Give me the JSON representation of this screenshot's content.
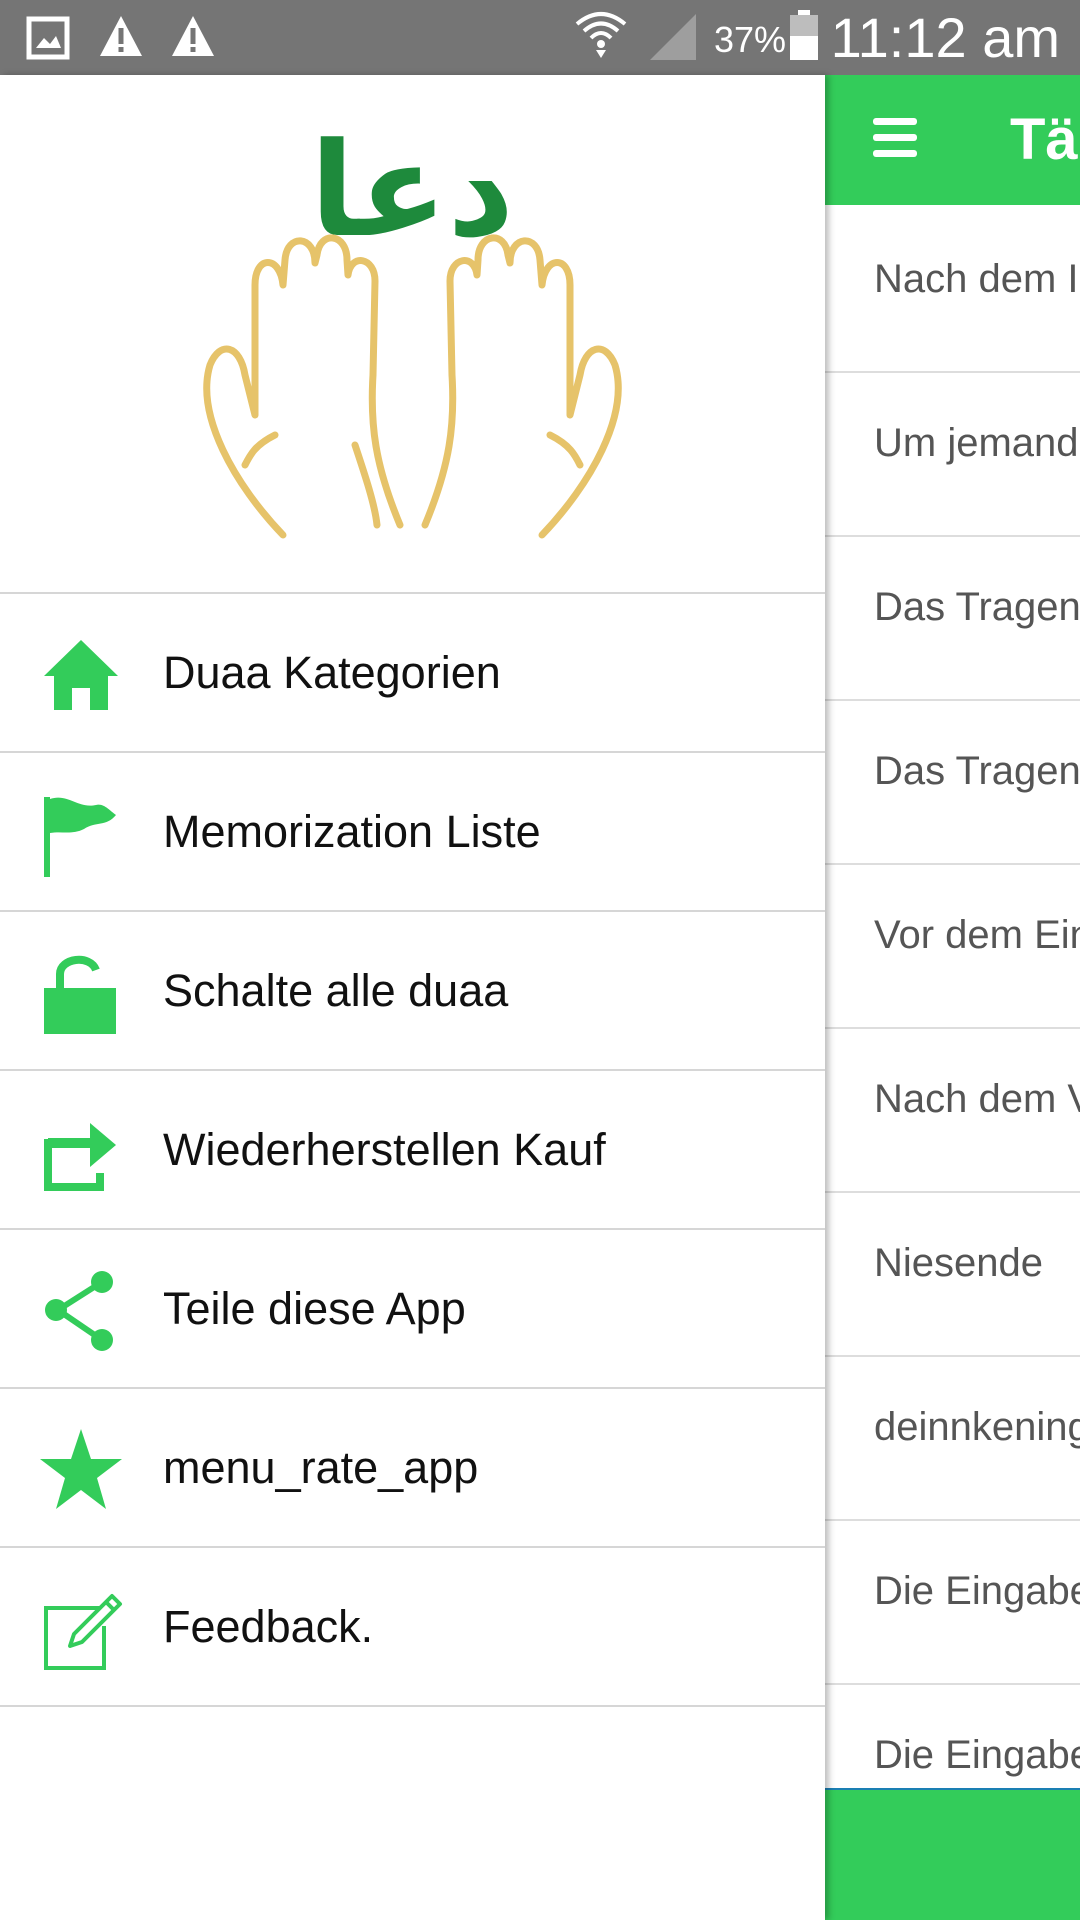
{
  "status_bar": {
    "battery": "37%",
    "time": "11:12 am",
    "icons": [
      "gallery-icon",
      "warning-icon",
      "warning-icon",
      "wifi-icon",
      "signal-icon",
      "battery-icon"
    ]
  },
  "app_bar": {
    "title": "Täg",
    "menu_icon": "hamburger-icon"
  },
  "background_list": {
    "items": [
      "Nach dem I",
      "Um jemand",
      "Das Tragen",
      "Das Tragen",
      "Vor dem Ein",
      "Nach dem V",
      "Niesende",
      "deinnkening",
      "Die Eingabe",
      "Die Eingabe"
    ]
  },
  "drawer": {
    "logo_text": "دعا",
    "menu": [
      {
        "label": "Duaa Kategorien",
        "icon": "home-icon"
      },
      {
        "label": "Memorization Liste",
        "icon": "flag-icon"
      },
      {
        "label": "Schalte alle duaa",
        "icon": "unlock-icon"
      },
      {
        "label": "Wiederherstellen Kauf",
        "icon": "restore-icon"
      },
      {
        "label": "Teile diese App",
        "icon": "share-icon"
      },
      {
        "label": "menu_rate_app",
        "icon": "star-icon"
      },
      {
        "label": "Feedback.",
        "icon": "edit-icon"
      }
    ]
  },
  "colors": {
    "accent": "#33cc5a",
    "status_bar": "#757575",
    "logo_green": "#1e8a3c",
    "logo_gold": "#e6c36a"
  }
}
